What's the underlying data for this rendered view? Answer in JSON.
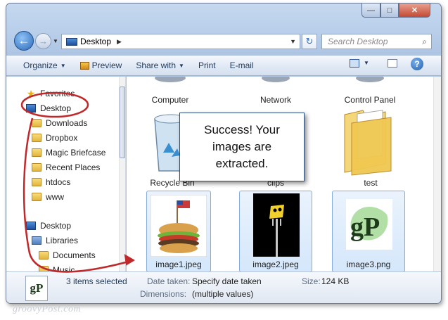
{
  "window": {
    "minimize_glyph": "—",
    "maximize_glyph": "□",
    "close_glyph": "✕"
  },
  "address": {
    "location": "Desktop",
    "separator": "▶"
  },
  "search": {
    "placeholder": "Search Desktop"
  },
  "toolbar": {
    "organize": "Organize",
    "preview": "Preview",
    "share_with": "Share with",
    "print": "Print",
    "email": "E-mail",
    "help_glyph": "?"
  },
  "nav_pane": {
    "items": [
      {
        "label": "Favorites",
        "icon": "star-icon"
      },
      {
        "label": "Desktop",
        "icon": "desktop-icon"
      },
      {
        "label": "Downloads",
        "icon": "folder-icon"
      },
      {
        "label": "Dropbox",
        "icon": "folder-icon"
      },
      {
        "label": "Magic Briefcase",
        "icon": "folder-icon"
      },
      {
        "label": "Recent Places",
        "icon": "folder-icon"
      },
      {
        "label": "htdocs",
        "icon": "folder-icon"
      },
      {
        "label": "www",
        "icon": "folder-icon"
      },
      {
        "label": "Desktop",
        "icon": "desktop-icon"
      },
      {
        "label": "Libraries",
        "icon": "library-icon"
      },
      {
        "label": "Documents",
        "icon": "folder-icon"
      },
      {
        "label": "Music",
        "icon": "folder-icon"
      }
    ]
  },
  "content": {
    "top_row": [
      "Computer",
      "Network",
      "Control Panel"
    ],
    "middle_row": [
      "Recycle Bin",
      "clips",
      "test"
    ],
    "files": [
      {
        "name": "image1.jpeg",
        "selected": true
      },
      {
        "name": "image2.jpeg",
        "selected": true
      },
      {
        "name": "image3.png",
        "selected": true
      }
    ]
  },
  "callout": {
    "lines": [
      "Success! Your",
      "images are",
      "extracted."
    ]
  },
  "details": {
    "selection": "3 items selected",
    "date_taken_label": "Date taken:",
    "date_taken_value": "Specify date taken",
    "dimensions_label": "Dimensions:",
    "dimensions_value": "(multiple values)",
    "size_label": "Size:",
    "size_value": "124 KB",
    "thumb_text": "gP"
  },
  "watermark": "groovyPost.com",
  "colors": {
    "annotation_red": "#c0282a",
    "accent_blue": "#2a68b8"
  }
}
